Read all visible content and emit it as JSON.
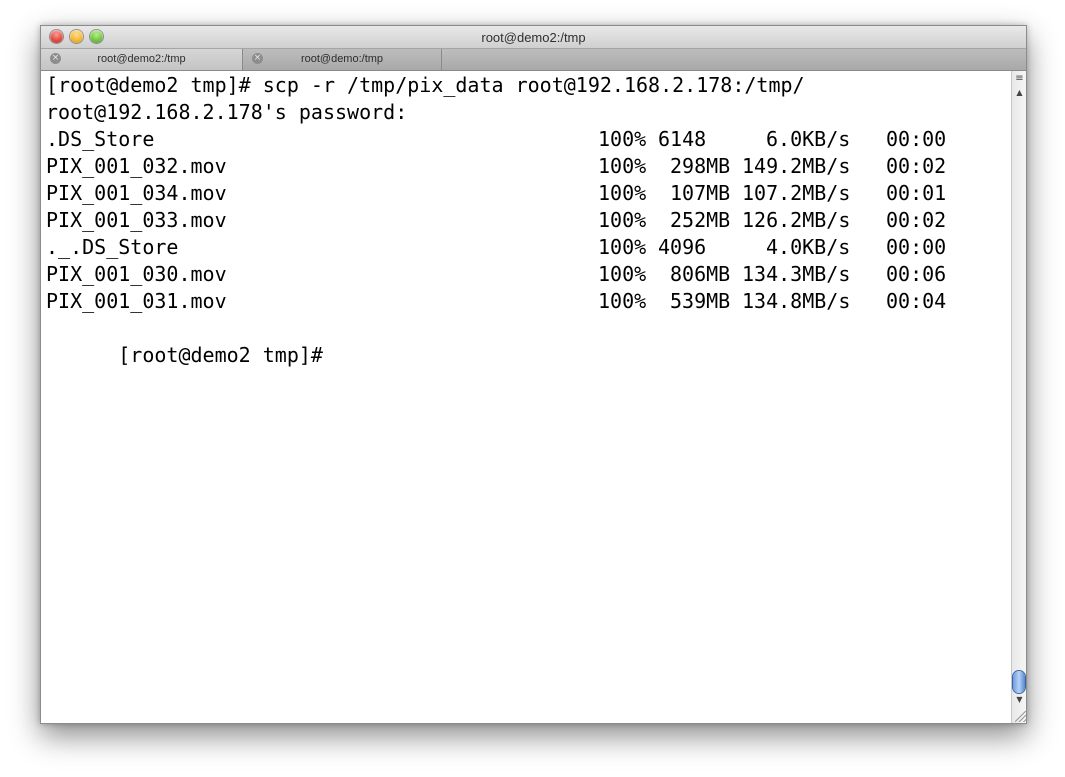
{
  "window": {
    "title": "root@demo2:/tmp"
  },
  "tabs": [
    {
      "label": "root@demo2:/tmp",
      "active": true,
      "close_icon": "×"
    },
    {
      "label": "root@demo:/tmp",
      "active": false,
      "close_icon": "×"
    }
  ],
  "terminal": {
    "command_line": "[root@demo2 tmp]# scp -r /tmp/pix_data root@192.168.2.178:/tmp/",
    "password_prompt": "root@192.168.2.178's password:",
    "transfers": [
      {
        "file": ".DS_Store",
        "percent": "100%",
        "size": "6148",
        "rate": "6.0KB/s",
        "time": "00:00"
      },
      {
        "file": "PIX_001_032.mov",
        "percent": "100%",
        "size": "298MB",
        "rate": "149.2MB/s",
        "time": "00:02"
      },
      {
        "file": "PIX_001_034.mov",
        "percent": "100%",
        "size": "107MB",
        "rate": "107.2MB/s",
        "time": "00:01"
      },
      {
        "file": "PIX_001_033.mov",
        "percent": "100%",
        "size": "252MB",
        "rate": "126.2MB/s",
        "time": "00:02"
      },
      {
        "file": "._.DS_Store",
        "percent": "100%",
        "size": "4096",
        "rate": "4.0KB/s",
        "time": "00:00"
      },
      {
        "file": "PIX_001_030.mov",
        "percent": "100%",
        "size": "806MB",
        "rate": "134.3MB/s",
        "time": "00:06"
      },
      {
        "file": "PIX_001_031.mov",
        "percent": "100%",
        "size": "539MB",
        "rate": "134.8MB/s",
        "time": "00:04"
      }
    ],
    "final_prompt": "[root@demo2 tmp]# "
  },
  "scrollbar": {
    "up_arrow": "▲",
    "down_arrow": "▼"
  },
  "icons": {
    "close": "close-icon",
    "minimize": "minimize-icon",
    "zoom": "zoom-icon",
    "scroll_up": "arrow-up-icon",
    "scroll_down": "arrow-down-icon",
    "resize": "resize-grip-icon"
  },
  "colors": {
    "close_button": "#e0443a",
    "minimize_button": "#f3b32d",
    "zoom_button": "#6cc33c",
    "terminal_background": "#ffffff",
    "terminal_text": "#000000",
    "scroll_thumb": "#6d9be0"
  }
}
